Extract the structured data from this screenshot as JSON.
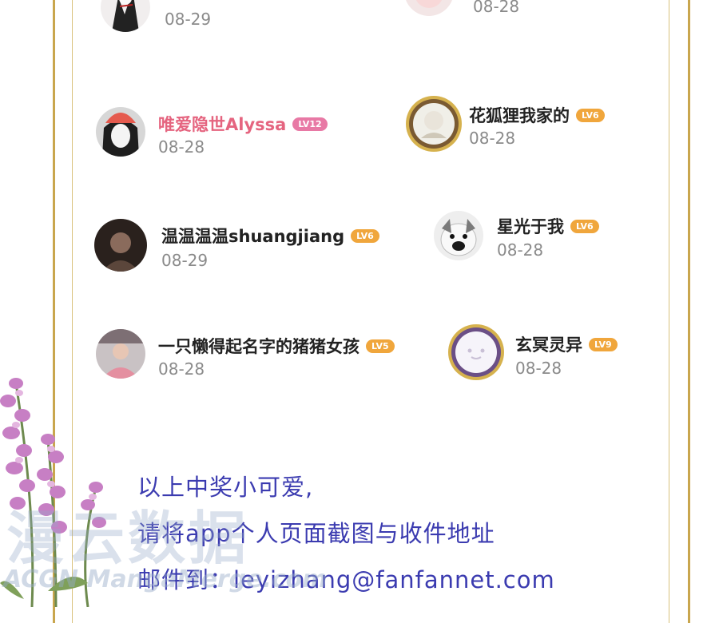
{
  "colors": {
    "frame_gold": "#c9a64e",
    "lv_orange": "#f0a63c",
    "lv_pink": "#e879a5",
    "footer_blue": "#3b3bb0",
    "name_pink": "#e5647f"
  },
  "winners": [
    {
      "name": "",
      "level": "",
      "date": "08-29"
    },
    {
      "name": "",
      "level": "",
      "date": "08-28"
    },
    {
      "name": "唯爱隐世Alyssa",
      "level": "LV12",
      "date": "08-28"
    },
    {
      "name": "花狐狸我家的",
      "level": "LV6",
      "date": "08-28"
    },
    {
      "name": "温温温温shuangjiang",
      "level": "LV6",
      "date": "08-29"
    },
    {
      "name": "星光于我",
      "level": "LV6",
      "date": "08-28"
    },
    {
      "name": "一只懒得起名字的猪猪女孩",
      "level": "LV5",
      "date": "08-28"
    },
    {
      "name": "玄冥灵异",
      "level": "LV9",
      "date": "08-28"
    }
  ],
  "footer": {
    "line1": "以上中奖小可爱,",
    "line2": "请将app个人页面截图与收件地址",
    "line3": "邮件到：leyizhang@fanfannet.com"
  },
  "watermark": {
    "main": "漫云数据",
    "sub": "ACGN MangaMerge.com"
  },
  "icons": {
    "decoration": "lavender-flower-icon"
  }
}
